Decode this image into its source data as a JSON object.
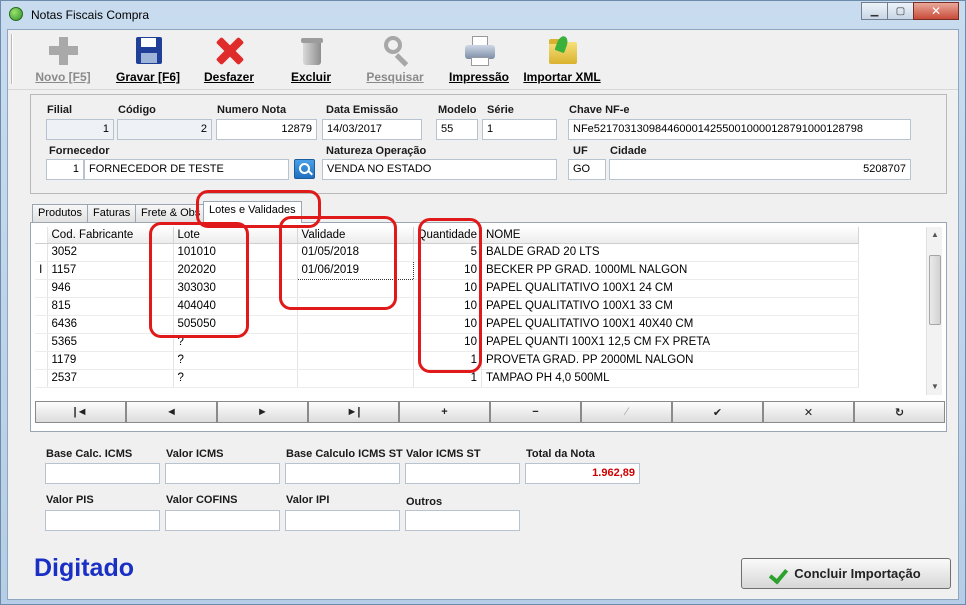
{
  "window": {
    "title": "Notas Fiscais Compra"
  },
  "toolbar": {
    "buttons": [
      {
        "label": "Novo [F5]",
        "icon": "plus-icon",
        "enabled": false
      },
      {
        "label": "Gravar [F6]",
        "icon": "floppy-disk-icon",
        "enabled": true
      },
      {
        "label": "Desfazer",
        "icon": "red-x-icon",
        "enabled": true
      },
      {
        "label": "Excluir",
        "icon": "trash-can-icon",
        "enabled": true
      },
      {
        "label": "Pesquisar",
        "icon": "magnifier-icon",
        "enabled": false
      },
      {
        "label": "Impressão",
        "icon": "printer-icon",
        "enabled": true
      },
      {
        "label": "Importar XML",
        "icon": "folder-import-icon",
        "enabled": true
      }
    ]
  },
  "header": {
    "filial": {
      "label": "Filial",
      "value": "1"
    },
    "codigo": {
      "label": "Código",
      "value": "2"
    },
    "numero_nota": {
      "label": "Numero Nota",
      "value": "12879"
    },
    "data_emissao": {
      "label": "Data Emissão",
      "value": "14/03/2017"
    },
    "modelo": {
      "label": "Modelo",
      "value": "55"
    },
    "serie": {
      "label": "Série",
      "value": "1"
    },
    "chave": {
      "label": "Chave NF-e",
      "value": "NFe52170313098446000142550010000128791000128798"
    },
    "fornecedor": {
      "label": "Fornecedor",
      "code": "1",
      "name": "FORNECEDOR DE TESTE"
    },
    "natureza": {
      "label": "Natureza Operação",
      "value": "VENDA NO ESTADO"
    },
    "uf": {
      "label": "UF",
      "value": "GO"
    },
    "cidade": {
      "label": "Cidade",
      "value": "5208707"
    }
  },
  "tabs": [
    {
      "label": "Produtos",
      "active": false
    },
    {
      "label": "Faturas",
      "active": false
    },
    {
      "label": "Frete & Obs",
      "active": false
    },
    {
      "label": "Lotes e Validades",
      "active": true
    }
  ],
  "grid": {
    "columns": [
      "Cod. Fabricante",
      "Lote",
      "Validade",
      "Quantidade",
      "NOME"
    ],
    "rows": [
      {
        "cod": "3052",
        "lote": "101010",
        "validade": "01/05/2018",
        "qtd": "5",
        "nome": "BALDE GRAD 20 LTS",
        "indicator": ""
      },
      {
        "cod": "1157",
        "lote": "202020",
        "validade": "01/06/2019",
        "qtd": "10",
        "nome": "BECKER PP GRAD. 1000ML NALGON",
        "indicator": "I"
      },
      {
        "cod": "946",
        "lote": "303030",
        "validade": "",
        "qtd": "10",
        "nome": "PAPEL QUALITATIVO 100X1 24 CM",
        "indicator": ""
      },
      {
        "cod": "815",
        "lote": "404040",
        "validade": "",
        "qtd": "10",
        "nome": "PAPEL QUALITATIVO 100X1 33 CM",
        "indicator": ""
      },
      {
        "cod": "6436",
        "lote": "505050",
        "validade": "",
        "qtd": "10",
        "nome": "PAPEL QUALITATIVO 100X1 40X40 CM",
        "indicator": ""
      },
      {
        "cod": "5365",
        "lote": "?",
        "validade": "",
        "qtd": "10",
        "nome": "PAPEL QUANTI 100X1 12,5 CM FX PRETA",
        "indicator": ""
      },
      {
        "cod": "1179",
        "lote": "?",
        "validade": "",
        "qtd": "1",
        "nome": "PROVETA GRAD. PP 2000ML NALGON",
        "indicator": ""
      },
      {
        "cod": "2537",
        "lote": "?",
        "validade": "",
        "qtd": "1",
        "nome": "TAMPAO PH 4,0 500ML",
        "indicator": ""
      }
    ]
  },
  "navigator": [
    {
      "symbol": "|◄",
      "name": "first-record-button",
      "enabled": true
    },
    {
      "symbol": "◄",
      "name": "prior-record-button",
      "enabled": true
    },
    {
      "symbol": "►",
      "name": "next-record-button",
      "enabled": true
    },
    {
      "symbol": "►|",
      "name": "last-record-button",
      "enabled": true
    },
    {
      "symbol": "+",
      "name": "insert-record-button",
      "enabled": true
    },
    {
      "symbol": "−",
      "name": "delete-record-button",
      "enabled": true
    },
    {
      "symbol": "⁄",
      "name": "edit-record-button",
      "enabled": false
    },
    {
      "symbol": "✔",
      "name": "post-record-button",
      "enabled": true
    },
    {
      "symbol": "✕",
      "name": "cancel-record-button",
      "enabled": true
    },
    {
      "symbol": "↻",
      "name": "refresh-records-button",
      "enabled": true
    }
  ],
  "totals": {
    "base_icms": {
      "label": "Base Calc. ICMS",
      "value": ""
    },
    "valor_icms": {
      "label": "Valor ICMS",
      "value": ""
    },
    "base_icms_st": {
      "label": "Base Calculo ICMS ST",
      "value": ""
    },
    "valor_icms_st": {
      "label": "Valor ICMS ST",
      "value": ""
    },
    "total_nota": {
      "label": "Total da Nota",
      "value": "1.962,89"
    },
    "valor_pis": {
      "label": "Valor PIS",
      "value": ""
    },
    "valor_cofins": {
      "label": "Valor COFINS",
      "value": ""
    },
    "valor_ipi": {
      "label": "Valor IPI",
      "value": ""
    },
    "outros": {
      "label": "Outros",
      "value": ""
    }
  },
  "status": {
    "text": "Digitado"
  },
  "actions": {
    "concluir_label": "Concluir Importação"
  },
  "colors": {
    "status_text": "#1a2fc4",
    "total_value": "#d00000",
    "annotation": "#e01a1a"
  }
}
